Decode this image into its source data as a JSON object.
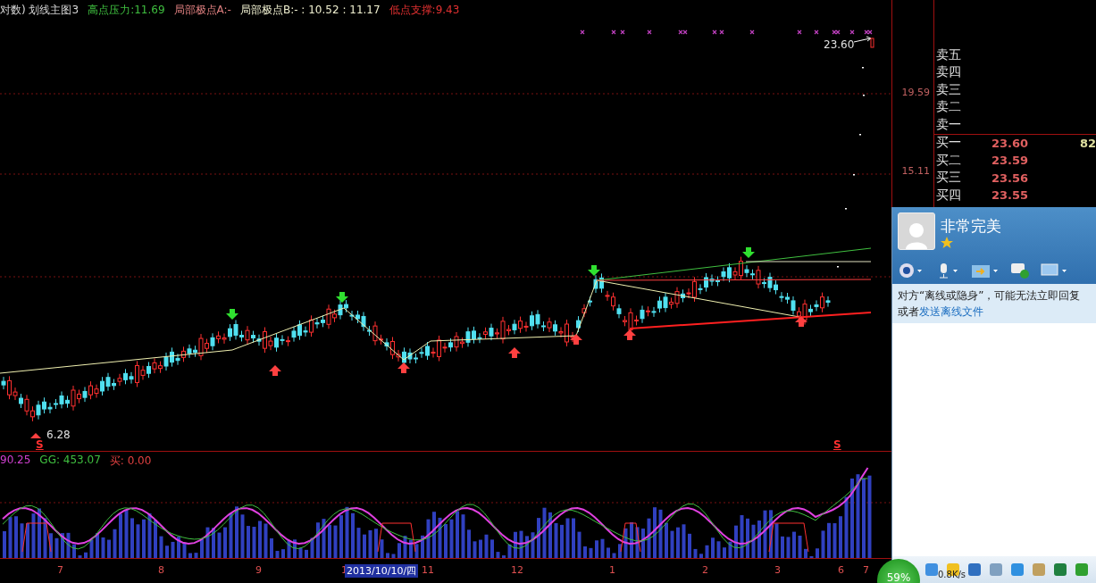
{
  "main_chart": {
    "title": "对数) 划线主图3",
    "indicators": [
      {
        "label": "高点压力:",
        "value": "11.69",
        "color": "#3fbf3f"
      },
      {
        "label": "局部极点A:",
        "value": "-",
        "color": "#e08080"
      },
      {
        "label": "局部极点B:",
        "value": "- : 10.52 : 11.17",
        "color": "#f0f0d0"
      },
      {
        "label": "低点支撑:",
        "value": "9.43",
        "color": "#e03030"
      }
    ],
    "high_label": "23.60",
    "low_label": "6.28",
    "signal_marks": [
      "S",
      "S"
    ]
  },
  "price_axis": [
    "19.59",
    "15.11"
  ],
  "sub_chart": {
    "indicators": [
      {
        "label": "90.25",
        "color": "#d040d0"
      },
      {
        "label": "GG: 453.07",
        "color": "#40c040"
      },
      {
        "label": "买: 0.00",
        "color": "#e04040"
      }
    ]
  },
  "time_axis": [
    {
      "label": "7",
      "kind": "tick"
    },
    {
      "label": "8",
      "kind": "tick"
    },
    {
      "label": "9",
      "kind": "tick"
    },
    {
      "label": "1",
      "kind": "tick"
    },
    {
      "label": "2013/10/10/四",
      "kind": "cursor"
    },
    {
      "label": "11",
      "kind": "tick"
    },
    {
      "label": "12",
      "kind": "tick"
    },
    {
      "label": "1",
      "kind": "tick"
    },
    {
      "label": "2",
      "kind": "tick"
    },
    {
      "label": "3",
      "kind": "tick"
    },
    {
      "label": "6",
      "kind": "tick"
    },
    {
      "label": "7",
      "kind": "tick"
    }
  ],
  "order_book": {
    "sell": [
      "卖五",
      "卖四",
      "卖三",
      "卖二",
      "卖一"
    ],
    "buy": [
      {
        "label": "买一",
        "price": "23.60",
        "volume": "82"
      },
      {
        "label": "买二",
        "price": "23.59"
      },
      {
        "label": "买三",
        "price": "23.56"
      },
      {
        "label": "买四",
        "price": "23.55"
      }
    ]
  },
  "chat_window": {
    "name": "非常完美",
    "notice": "对方“离线或隐身”，可能无法立即回复",
    "notice_prefix": "或者",
    "notice_link": "发送离线文件"
  },
  "status": {
    "percent": "59%",
    "speed": "0.8K/s"
  }
}
